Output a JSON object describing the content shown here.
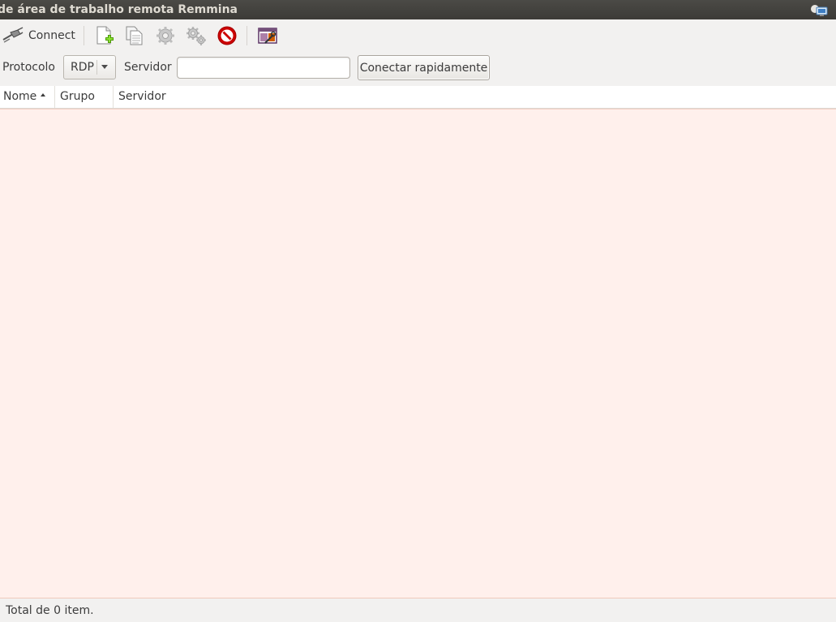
{
  "window": {
    "title": "de área de trabalho remota Remmina"
  },
  "toolbar": {
    "connect_label": "Connect",
    "buttons": [
      {
        "name": "new-connection",
        "icon": "new-file-icon"
      },
      {
        "name": "copy-connection",
        "icon": "copy-icon"
      },
      {
        "name": "edit-connection",
        "icon": "gear-icon"
      },
      {
        "name": "preferences",
        "icon": "gears-icon"
      },
      {
        "name": "delete-connection",
        "icon": "no-entry-icon"
      },
      {
        "name": "tools",
        "icon": "window-tools-icon"
      }
    ]
  },
  "quickconnect": {
    "protocol_label": "Protocolo",
    "protocol_value": "RDP",
    "server_label": "Servidor",
    "server_value": "",
    "button_label": "Conectar rapidamente"
  },
  "list": {
    "columns": [
      "Nome",
      "Grupo",
      "Servidor"
    ],
    "rows": []
  },
  "status": {
    "text": "Total de 0 item."
  },
  "colors": {
    "titlebar": "#3c3b37",
    "list_background": "#fff0ec",
    "window_background": "#f2f1f0"
  }
}
